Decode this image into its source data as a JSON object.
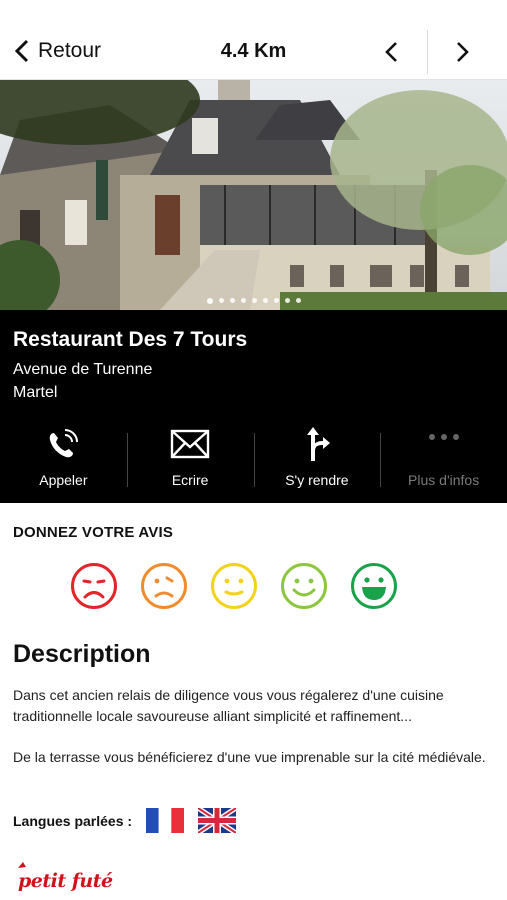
{
  "header": {
    "back_label": "Retour",
    "distance": "4.4 Km",
    "back_icon": "chevron-left-icon",
    "prev_icon": "chevron-left-icon",
    "next_icon": "chevron-right-icon"
  },
  "gallery": {
    "image_description": "photo-stone-inn-building",
    "dot_count": 9,
    "active_dot": 0
  },
  "place": {
    "name": "Restaurant Des 7 Tours",
    "street": "Avenue de Turenne",
    "city": "Martel"
  },
  "actions": [
    {
      "label": "Appeler",
      "icon": "phone-icon"
    },
    {
      "label": "Ecrire",
      "icon": "envelope-icon"
    },
    {
      "label": "S'y rendre",
      "icon": "directions-icon"
    },
    {
      "label": "Plus d'infos",
      "icon": "more-dots-icon"
    }
  ],
  "rating": {
    "title": "DONNEZ VOTRE AVIS",
    "levels": [
      {
        "icon": "very-sad-face-icon",
        "color": "#e2242b"
      },
      {
        "icon": "sad-face-icon",
        "color": "#f08c2e"
      },
      {
        "icon": "neutral-face-icon",
        "color": "#f2d21b"
      },
      {
        "icon": "happy-face-icon",
        "color": "#8cc63f"
      },
      {
        "icon": "very-happy-face-icon",
        "color": "#1aa24b"
      }
    ]
  },
  "description": {
    "title": "Description",
    "paragraph1": "Dans cet ancien relais de diligence  vous vous régalerez d'une cuisine traditionnelle locale savoureuse alliant simplicité et raffinement...",
    "paragraph2": "De la terrasse vous bénéficierez d'une vue imprenable sur la cité médiévale."
  },
  "languages": {
    "label": "Langues parlées :",
    "flags": [
      "french-flag-icon",
      "uk-flag-icon"
    ]
  },
  "brand": {
    "logo_text": "petit futé",
    "color": "#d0121b"
  }
}
